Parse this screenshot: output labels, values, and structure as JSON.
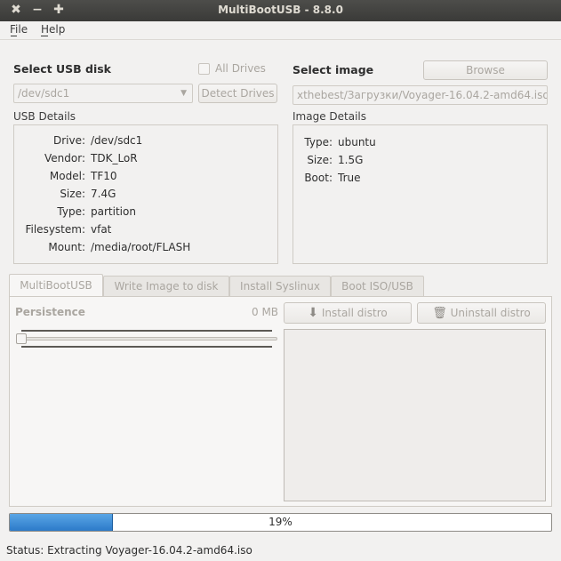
{
  "window": {
    "title": "MultiBootUSB - 8.8.0"
  },
  "menu": {
    "file": "File",
    "help": "Help"
  },
  "usb": {
    "header": "Select USB disk",
    "all_drives_label": "All Drives",
    "all_drives_checked": false,
    "selected_disk": "/dev/sdc1",
    "detect_button": "Detect Drives",
    "details_header": "USB Details",
    "details": [
      {
        "key": "Drive:",
        "value": "/dev/sdc1"
      },
      {
        "key": "Vendor:",
        "value": "TDK_LoR"
      },
      {
        "key": "Model:",
        "value": "TF10"
      },
      {
        "key": "Size:",
        "value": "7.4G"
      },
      {
        "key": "Type:",
        "value": "partition"
      },
      {
        "key": "Filesystem:",
        "value": "vfat"
      },
      {
        "key": "Mount:",
        "value": "/media/root/FLASH"
      }
    ]
  },
  "image": {
    "header": "Select image",
    "browse_button": "Browse",
    "path": "xthebest/Загрузки/Voyager-16.04.2-amd64.iso",
    "details_header": "Image Details",
    "details": [
      {
        "key": "Type:",
        "value": "ubuntu"
      },
      {
        "key": "Size:",
        "value": "1.5G"
      },
      {
        "key": "Boot:",
        "value": "True"
      }
    ]
  },
  "tabs": [
    {
      "label": "MultiBootUSB",
      "active": true
    },
    {
      "label": "Write Image to disk",
      "active": false
    },
    {
      "label": "Install Syslinux",
      "active": false
    },
    {
      "label": "Boot ISO/USB",
      "active": false
    }
  ],
  "multiboot": {
    "persistence_label": "Persistence",
    "persistence_value": "0 MB",
    "persistence_slider_fraction": 0,
    "install_button": "Install distro",
    "uninstall_button": "Uninstall distro"
  },
  "progress": {
    "percent": 19,
    "text": "19%"
  },
  "status": {
    "text": "Status: Extracting Voyager-16.04.2-amd64.iso"
  },
  "colors": {
    "progress_fill": "#2c7ac9",
    "titlebar": "#3a3a38",
    "window_bg": "#f2f1f0"
  }
}
